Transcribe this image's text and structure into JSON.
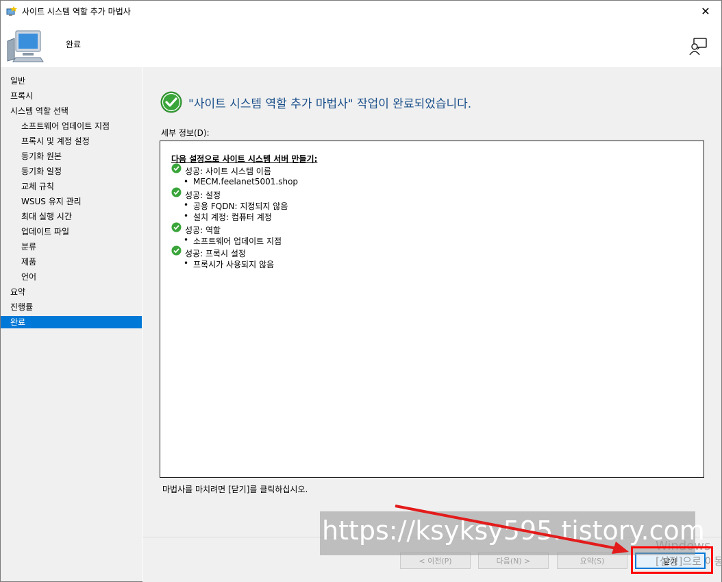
{
  "window": {
    "title": "사이트 시스템 역할 추가 마법사",
    "close_glyph": "✕"
  },
  "header": {
    "title": "완료"
  },
  "sidebar": {
    "items": [
      {
        "label": "일반",
        "level": 1
      },
      {
        "label": "프록시",
        "level": 1
      },
      {
        "label": "시스템 역할 선택",
        "level": 1
      },
      {
        "label": "소프트웨어 업데이트 지점",
        "level": 2
      },
      {
        "label": "프록시 및 계정 설정",
        "level": 2
      },
      {
        "label": "동기화 원본",
        "level": 2
      },
      {
        "label": "동기화 일정",
        "level": 2
      },
      {
        "label": "교체 규칙",
        "level": 2
      },
      {
        "label": "WSUS 유지 관리",
        "level": 2
      },
      {
        "label": "최대 실행 시간",
        "level": 2
      },
      {
        "label": "업데이트 파일",
        "level": 2
      },
      {
        "label": "분류",
        "level": 2
      },
      {
        "label": "제품",
        "level": 2
      },
      {
        "label": "언어",
        "level": 2
      },
      {
        "label": "요약",
        "level": 1
      },
      {
        "label": "진행률",
        "level": 1
      },
      {
        "label": "완료",
        "level": 1,
        "active": true
      }
    ]
  },
  "main": {
    "headline": "\"사이트 시스템 역할 추가 마법사\" 작업이 완료되었습니다.",
    "details_label": "세부 정보(D):",
    "details": {
      "header": "다음 설정으로 사이트 시스템 서버 만들기:",
      "sections": [
        {
          "title": "성공: 사이트 시스템 이름",
          "bullets": [
            "MECM.feelanet5001.shop"
          ]
        },
        {
          "title": "성공: 설정",
          "bullets": [
            "공용 FQDN: 지정되지 않음",
            "설치 계정: 컴퓨터 계정"
          ]
        },
        {
          "title": "성공: 역할",
          "bullets": [
            "소프트웨어 업데이트 지점"
          ]
        },
        {
          "title": "성공: 프록시 설정",
          "bullets": [
            "프록시가 사용되지 않음"
          ]
        }
      ]
    },
    "footer_note": "마법사를 마치려면 [닫기]를 클릭하십시오."
  },
  "buttons": {
    "prev": "< 이전(P)",
    "next": "다음(N) >",
    "summary": "요약(S)",
    "close": "닫기"
  },
  "overlay": {
    "watermark": "https://ksyksy595.tistory.com",
    "windows_line1": "Windows",
    "windows_line2": "[설정]으로 이동"
  },
  "colors": {
    "accent": "#0078d7",
    "headline": "#1a4f8a",
    "highlight": "#ff0000",
    "success": "#3aa53a"
  }
}
